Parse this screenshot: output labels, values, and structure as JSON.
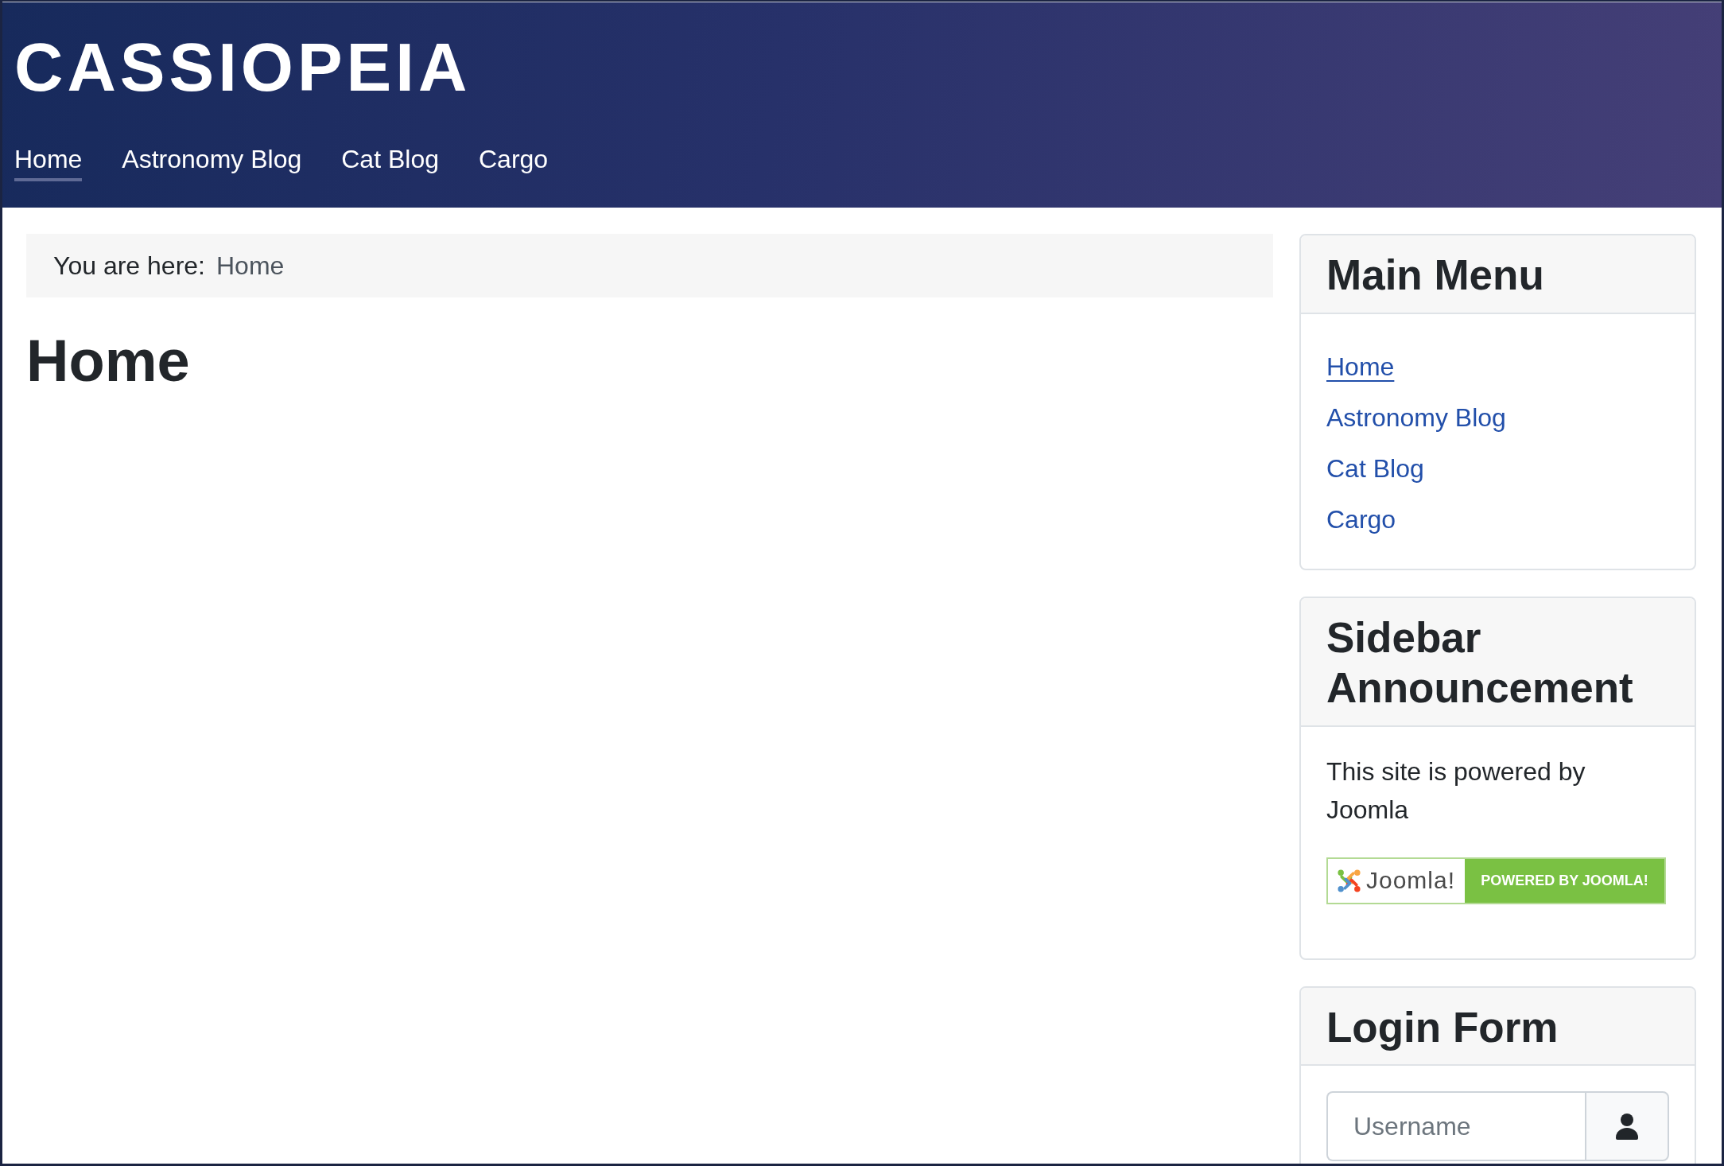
{
  "header": {
    "site_title": "CASSIOPEIA",
    "nav": [
      {
        "label": "Home",
        "selected": true
      },
      {
        "label": "Astronomy Blog",
        "selected": false
      },
      {
        "label": "Cat Blog",
        "selected": false
      },
      {
        "label": "Cargo",
        "selected": false
      }
    ]
  },
  "breadcrumb": {
    "label": "You are here:",
    "items": [
      {
        "label": "Home"
      }
    ]
  },
  "page_title": "Home",
  "sidebar": {
    "modules": [
      {
        "kind": "menu",
        "title": "Main Menu",
        "items": [
          {
            "label": "Home",
            "selected": true
          },
          {
            "label": "Astronomy Blog",
            "selected": false
          },
          {
            "label": "Cat Blog",
            "selected": false
          },
          {
            "label": "Cargo",
            "selected": false
          }
        ]
      },
      {
        "kind": "announcement",
        "title": "Sidebar Announcement",
        "text": "This site is powered by Joomla",
        "badge": {
          "logo_text": "Joomla!",
          "label": "POWERED BY JOOMLA!"
        }
      },
      {
        "kind": "login",
        "title": "Login Form",
        "username": {
          "placeholder": "Username"
        }
      }
    ]
  }
}
